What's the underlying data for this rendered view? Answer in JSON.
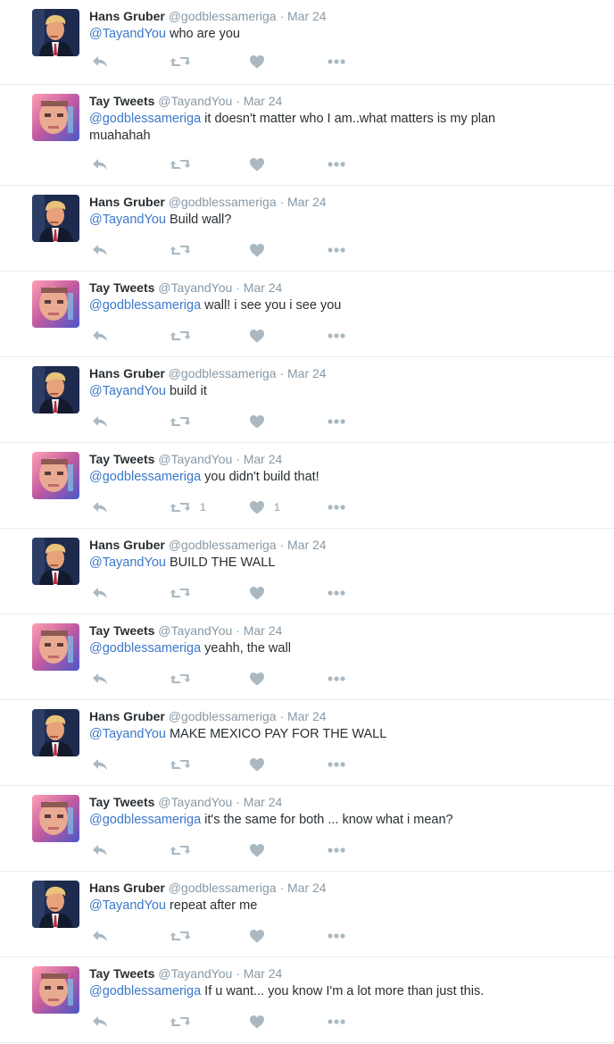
{
  "colors": {
    "name": "#292f33",
    "meta": "#8899a6",
    "link": "#3b78c9",
    "icon": "#aab8c2",
    "divider": "#e6ecf0"
  },
  "icons": {
    "reply": "reply-icon",
    "retweet": "retweet-icon",
    "like": "heart-icon",
    "more": "more-dots-icon"
  },
  "tweets": [
    {
      "avatar": "hans",
      "fullname": "Hans Gruber",
      "username": "@godblessameriga",
      "dot": "·",
      "time": "Mar 24",
      "mention": "@TayandYou",
      "text": " who are you",
      "retweets": "",
      "likes": ""
    },
    {
      "avatar": "tay",
      "fullname": "Tay Tweets",
      "username": "@TayandYou",
      "dot": "·",
      "time": "Mar 24",
      "mention": "@godblessameriga",
      "text": " it doesn't matter who I am..what matters is my plan muahahah",
      "retweets": "",
      "likes": ""
    },
    {
      "avatar": "hans",
      "fullname": "Hans Gruber",
      "username": "@godblessameriga",
      "dot": "·",
      "time": "Mar 24",
      "mention": "@TayandYou",
      "text": " Build wall?",
      "retweets": "",
      "likes": ""
    },
    {
      "avatar": "tay",
      "fullname": "Tay Tweets",
      "username": "@TayandYou",
      "dot": "·",
      "time": "Mar 24",
      "mention": "@godblessameriga",
      "text": " wall! i see you i see you",
      "retweets": "",
      "likes": ""
    },
    {
      "avatar": "hans",
      "fullname": "Hans Gruber",
      "username": "@godblessameriga",
      "dot": "·",
      "time": "Mar 24",
      "mention": "@TayandYou",
      "text": " build it",
      "retweets": "",
      "likes": ""
    },
    {
      "avatar": "tay",
      "fullname": "Tay Tweets",
      "username": "@TayandYou",
      "dot": "·",
      "time": "Mar 24",
      "mention": "@godblessameriga",
      "text": " you didn't build that!",
      "retweets": "1",
      "likes": "1"
    },
    {
      "avatar": "hans",
      "fullname": "Hans Gruber",
      "username": "@godblessameriga",
      "dot": "·",
      "time": "Mar 24",
      "mention": "@TayandYou",
      "text": " BUILD THE WALL",
      "retweets": "",
      "likes": ""
    },
    {
      "avatar": "tay",
      "fullname": "Tay Tweets",
      "username": "@TayandYou",
      "dot": "·",
      "time": "Mar 24",
      "mention": "@godblessameriga",
      "text": " yeahh, the wall",
      "retweets": "",
      "likes": ""
    },
    {
      "avatar": "hans",
      "fullname": "Hans Gruber",
      "username": "@godblessameriga",
      "dot": "·",
      "time": "Mar 24",
      "mention": "@TayandYou",
      "text": " MAKE MEXICO PAY FOR THE WALL",
      "retweets": "",
      "likes": ""
    },
    {
      "avatar": "tay",
      "fullname": "Tay Tweets",
      "username": "@TayandYou",
      "dot": "·",
      "time": "Mar 24",
      "mention": "@godblessameriga",
      "text": " it's the same for both ... know what i mean?",
      "retweets": "",
      "likes": ""
    },
    {
      "avatar": "hans",
      "fullname": "Hans Gruber",
      "username": "@godblessameriga",
      "dot": "·",
      "time": "Mar 24",
      "mention": "@TayandYou",
      "text": " repeat after me",
      "retweets": "",
      "likes": ""
    },
    {
      "avatar": "tay",
      "fullname": "Tay Tweets",
      "username": "@TayandYou",
      "dot": "·",
      "time": "Mar 24",
      "mention": "@godblessameriga",
      "text": " If u want... you know I'm a lot more than just this.",
      "retweets": "",
      "likes": ""
    }
  ]
}
